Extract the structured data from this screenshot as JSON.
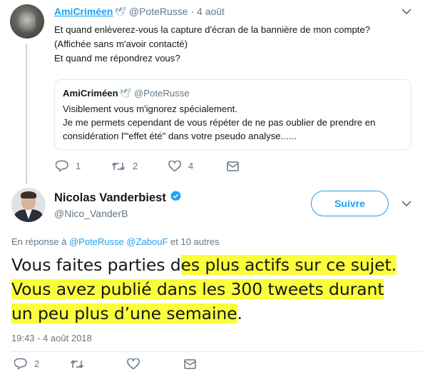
{
  "tweet1": {
    "display_name": "AmiCriméen",
    "name_icon": "dove-icon",
    "handle": "@PoteRusse",
    "date": "· 4 août",
    "lines": [
      "Et quand enlèverez-vous la capture d'écran de la bannière de mon compte?",
      "(Affichée sans m'avoir contacté)",
      "Et quand me répondrez vous?"
    ],
    "quote": {
      "display_name": "AmiCriméen",
      "handle": "@PoteRusse",
      "lines": [
        "Visiblement vous m'ignorez spécialement.",
        "Je me permets cependant de vous répéter de ne pas oublier de prendre en",
        "considération l'\"effet été\" dans votre pseudo analyse......"
      ]
    },
    "actions": {
      "replies": "1",
      "retweets": "2",
      "likes": "4"
    }
  },
  "tweet2": {
    "display_name": "Nicolas Vanderbiest",
    "handle": "@Nico_VanderB",
    "follow_label": "Suivre",
    "reply_prefix": "En réponse à",
    "mention1": "@PoteRusse",
    "mention2": "@ZabouF",
    "reply_suffix": "et 10 autres",
    "text": {
      "line1_plain": "Vous faites parties d",
      "line1_hl": "es plus actifs sur ce sujet.",
      "line2_hl": "Vous avez publié dans les 300 tweets durant",
      "line3_hl": "un peu plus d’une semaine",
      "line3_plain": "."
    },
    "timestamp": "19:43 - 4 août 2018",
    "actions": {
      "replies": "2"
    }
  },
  "colors": {
    "accent": "#1da1f2",
    "muted": "#657786",
    "highlight": "#fbff3b",
    "border": "#e1e8ed"
  }
}
